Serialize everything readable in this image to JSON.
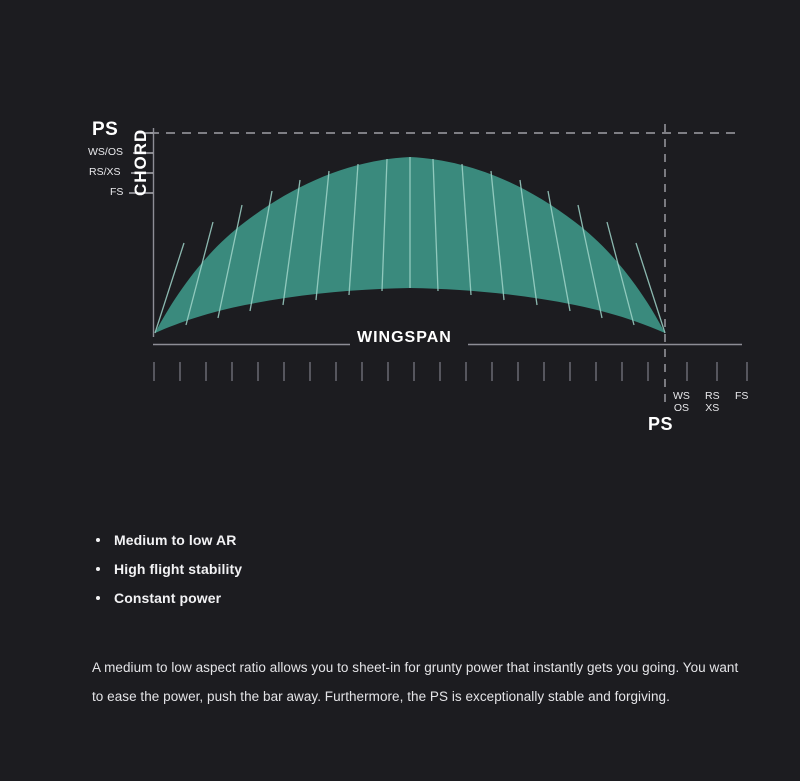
{
  "theme": {
    "background": "#1c1c20",
    "wing_fill": "#3a8a7d",
    "wing_cell_line": "#9fd4c9",
    "axis_line": "#8d8d95",
    "dashed_line": "#b9b9c0",
    "text": "#ffffff"
  },
  "diagram": {
    "y_axis": {
      "title": "CHORD",
      "ticks": [
        {
          "label": "PS",
          "emphasis": true
        },
        {
          "label": "WS/OS",
          "emphasis": false
        },
        {
          "label": "RS/XS",
          "emphasis": false
        },
        {
          "label": "FS",
          "emphasis": false
        }
      ]
    },
    "x_axis": {
      "title": "WINGSPAN",
      "highlight_label": "PS",
      "ticks": [
        {
          "line1": "WS",
          "line2": "OS"
        },
        {
          "line1": "RS",
          "line2": "XS"
        },
        {
          "line1": "FS",
          "line2": ""
        }
      ]
    }
  },
  "chart_data": {
    "type": "area",
    "title": "",
    "subtitle": "",
    "xlabel": "WINGSPAN",
    "ylabel": "CHORD",
    "legend_position": "none",
    "grid": false,
    "annotations": [
      {
        "text": "PS",
        "position": "y-axis-top",
        "style": "dashed-guide"
      },
      {
        "text": "PS",
        "position": "x-axis-right",
        "style": "dashed-guide"
      },
      {
        "text": "WS/OS",
        "position": "y-axis"
      },
      {
        "text": "RS/XS",
        "position": "y-axis"
      },
      {
        "text": "FS",
        "position": "y-axis"
      },
      {
        "text": "WS/OS",
        "position": "x-axis"
      },
      {
        "text": "RS/XS",
        "position": "x-axis"
      },
      {
        "text": "FS",
        "position": "x-axis"
      }
    ],
    "description": "Kite wing planform outline: arched leading edge peaking at PS chord level with an anhedral trailing edge; interior divided by radial cell seam lines.",
    "series": [
      {
        "name": "leading-edge",
        "x": [
          0,
          5,
          10,
          15,
          20,
          25,
          30,
          35,
          40,
          45,
          50,
          55,
          60,
          65,
          70,
          75,
          80,
          85,
          90,
          95,
          100
        ],
        "y": [
          42,
          57,
          69,
          79,
          87,
          92,
          96,
          98,
          100,
          100,
          100,
          100,
          100,
          98,
          96,
          92,
          87,
          79,
          69,
          57,
          42
        ]
      },
      {
        "name": "trailing-edge",
        "x": [
          0,
          5,
          10,
          15,
          20,
          25,
          30,
          35,
          40,
          45,
          50,
          55,
          60,
          65,
          70,
          75,
          80,
          85,
          90,
          95,
          100
        ],
        "y": [
          42,
          35,
          29,
          24,
          20,
          17,
          14,
          12,
          11,
          10,
          10,
          10,
          11,
          12,
          14,
          17,
          20,
          24,
          29,
          35,
          42
        ]
      }
    ],
    "cell_count": 16,
    "x_ticks_major": 20,
    "x_ticks_minor_right": 3,
    "ylim": [
      0,
      110
    ],
    "xlim": [
      0,
      100
    ]
  },
  "content": {
    "bullets": [
      "Medium to low AR",
      "High flight stability",
      "Constant power"
    ],
    "paragraph": "A medium to low aspect ratio allows you to sheet-in for grunty power that instantly gets you going. You want to ease the power, push the bar away. Furthermore, the PS is exceptionally stable and forgiving."
  }
}
